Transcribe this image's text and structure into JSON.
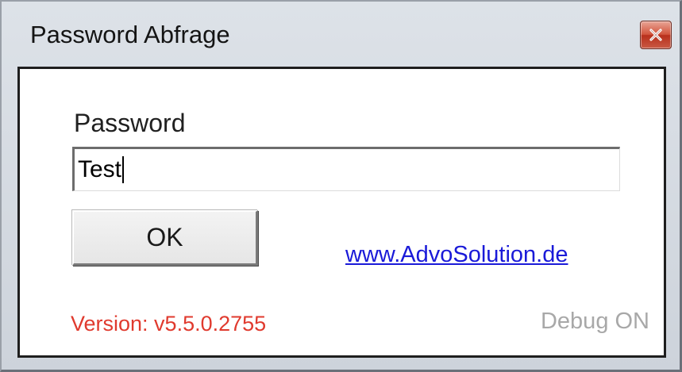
{
  "window": {
    "title": "Password Abfrage",
    "close_icon": "close-icon"
  },
  "form": {
    "password_label": "Password",
    "password_value": "Test",
    "ok_label": "OK",
    "link_text": "www.AdvoSolution.de",
    "version_text": "Version: v5.5.0.2755",
    "debug_text": "Debug ON"
  },
  "colors": {
    "link": "#1a1ad8",
    "version": "#e03a2e",
    "debug": "#a8a8a8",
    "close_button": "#c94a34"
  }
}
